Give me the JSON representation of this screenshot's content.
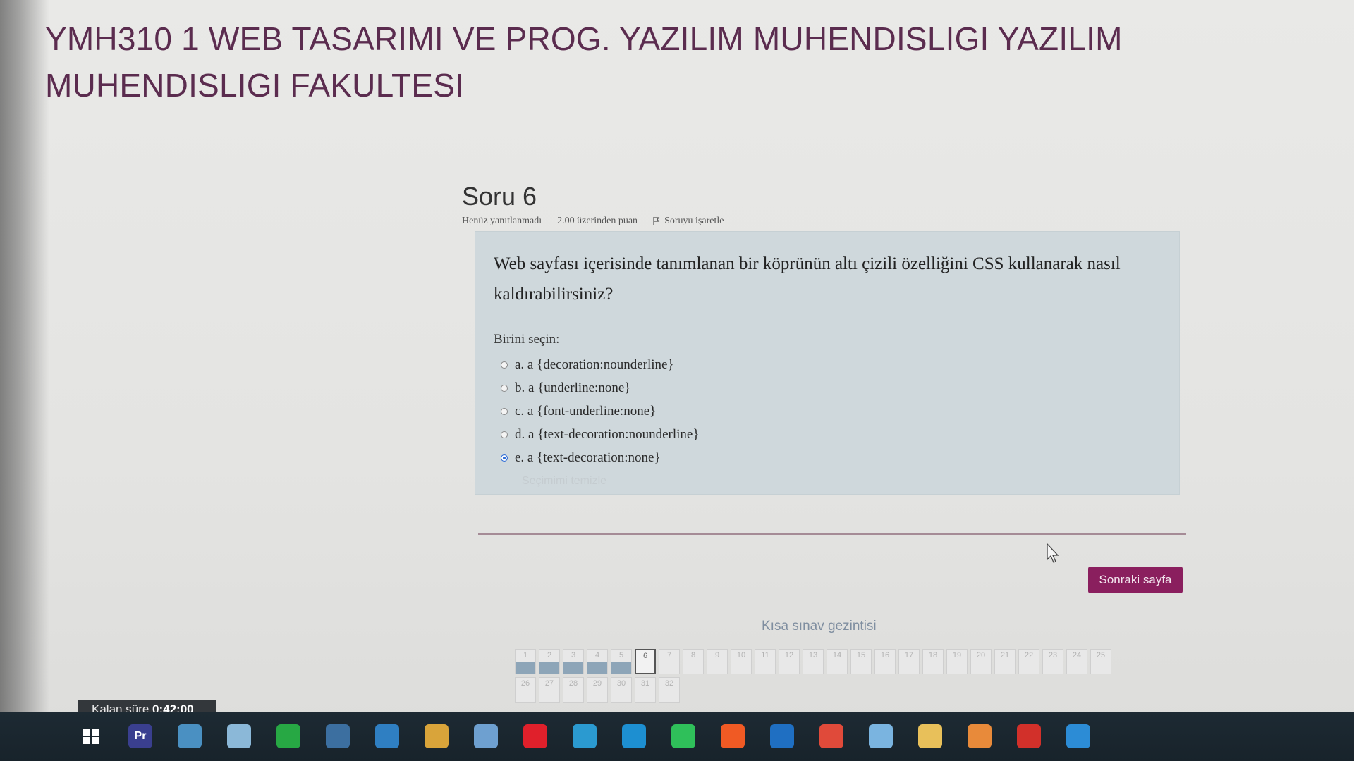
{
  "course": {
    "title": "YMH310 1 WEB TASARIMI VE PROG. YAZILIM MUHENDISLIGI YAZILIM MUHENDISLIGI FAKULTESI"
  },
  "question": {
    "number_label": "Soru 6",
    "status": "Henüz yanıtlanmadı",
    "points": "2.00 üzerinden puan",
    "flag_label": "Soruyu işaretle",
    "text": "Web sayfası içerisinde tanımlanan bir köprünün altı çizili özelliğini CSS kullanarak nasıl kaldırabilirsiniz?",
    "choose_label": "Birini seçin:",
    "answers": [
      {
        "label": "a. a {decoration:nounderline}",
        "selected": false
      },
      {
        "label": "b. a {underline:none}",
        "selected": false
      },
      {
        "label": "c. a {font-underline:none}",
        "selected": false
      },
      {
        "label": "d. a {text-decoration:nounderline}",
        "selected": false
      },
      {
        "label": "e. a {text-decoration:none}",
        "selected": true
      }
    ],
    "clear_label": "Seçimimi temizle"
  },
  "actions": {
    "next_label": "Sonraki sayfa"
  },
  "quiz_nav": {
    "title": "Kısa sınav gezintisi",
    "row1": [
      "1",
      "2",
      "3",
      "4",
      "5",
      "6",
      "7",
      "8",
      "9",
      "10",
      "11",
      "12",
      "13",
      "14",
      "15",
      "16",
      "17",
      "18",
      "19",
      "20",
      "21",
      "22",
      "23",
      "24",
      "25"
    ],
    "row2": [
      "26",
      "27",
      "28",
      "29",
      "30",
      "31",
      "32"
    ],
    "answered": [
      "1",
      "2",
      "3",
      "4",
      "5"
    ],
    "current": "6"
  },
  "timer": {
    "label": "Kalan süre",
    "value": "0:42:00"
  },
  "taskbar": {
    "icons": [
      {
        "name": "windows-start-icon",
        "color": "#ffffff"
      },
      {
        "name": "premiere-icon",
        "text": "Pr",
        "color": "#3a3f8f"
      },
      {
        "name": "file-explorer-icon",
        "color": "#4a90c2"
      },
      {
        "name": "paint-icon",
        "color": "#8bb8d8"
      },
      {
        "name": "circle-app-icon",
        "color": "#27a844"
      },
      {
        "name": "calculator-icon",
        "color": "#3c6fa0"
      },
      {
        "name": "mail-icon",
        "color": "#2f7fc2"
      },
      {
        "name": "folder-icon",
        "color": "#d9a43a"
      },
      {
        "name": "notes-icon",
        "color": "#6ea0d0"
      },
      {
        "name": "opera-icon",
        "color": "#e0202b"
      },
      {
        "name": "store-app-icon",
        "color": "#2b9ad0"
      },
      {
        "name": "edge-icon",
        "color": "#1d8fd1"
      },
      {
        "name": "whatsapp-icon",
        "color": "#2fc05a"
      },
      {
        "name": "brave-icon",
        "color": "#f05a24"
      },
      {
        "name": "outlook-icon",
        "color": "#1f6fc2"
      },
      {
        "name": "chrome-icon",
        "color": "#e04a3a"
      },
      {
        "name": "chat-icon",
        "color": "#7ab4e0"
      },
      {
        "name": "shopping-icon",
        "color": "#e8c05a"
      },
      {
        "name": "chrome-active-icon",
        "color": "#e88a3a"
      },
      {
        "name": "acrobat-icon",
        "color": "#d2302a"
      },
      {
        "name": "teamviewer-icon",
        "color": "#2c8cd6"
      }
    ]
  }
}
